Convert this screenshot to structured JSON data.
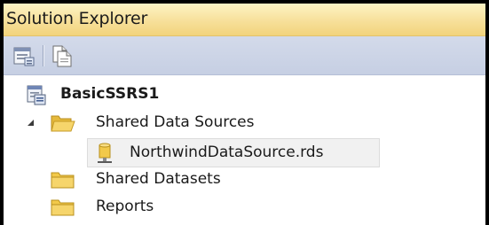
{
  "panel": {
    "title": "Solution Explorer"
  },
  "toolbar": {
    "buttons": [
      {
        "icon": "properties-icon"
      },
      {
        "icon": "show-all-files-icon"
      }
    ]
  },
  "tree": {
    "project": {
      "label": "BasicSSRS1",
      "icon": "project-icon"
    },
    "shared_data_sources": {
      "label": "Shared Data Sources",
      "expanded": true,
      "icon": "folder-open-icon",
      "children": [
        {
          "label": "NorthwindDataSource.rds",
          "icon": "datasource-icon",
          "selected": true
        }
      ]
    },
    "shared_datasets": {
      "label": "Shared Datasets",
      "icon": "folder-icon"
    },
    "reports": {
      "label": "Reports",
      "icon": "folder-icon"
    }
  },
  "colors": {
    "title_gradient_top": "#fdf3c4",
    "title_gradient_bottom": "#f2d37c",
    "toolbar_bg": "#ccd4e8",
    "folder_yellow": "#f2c94a"
  }
}
